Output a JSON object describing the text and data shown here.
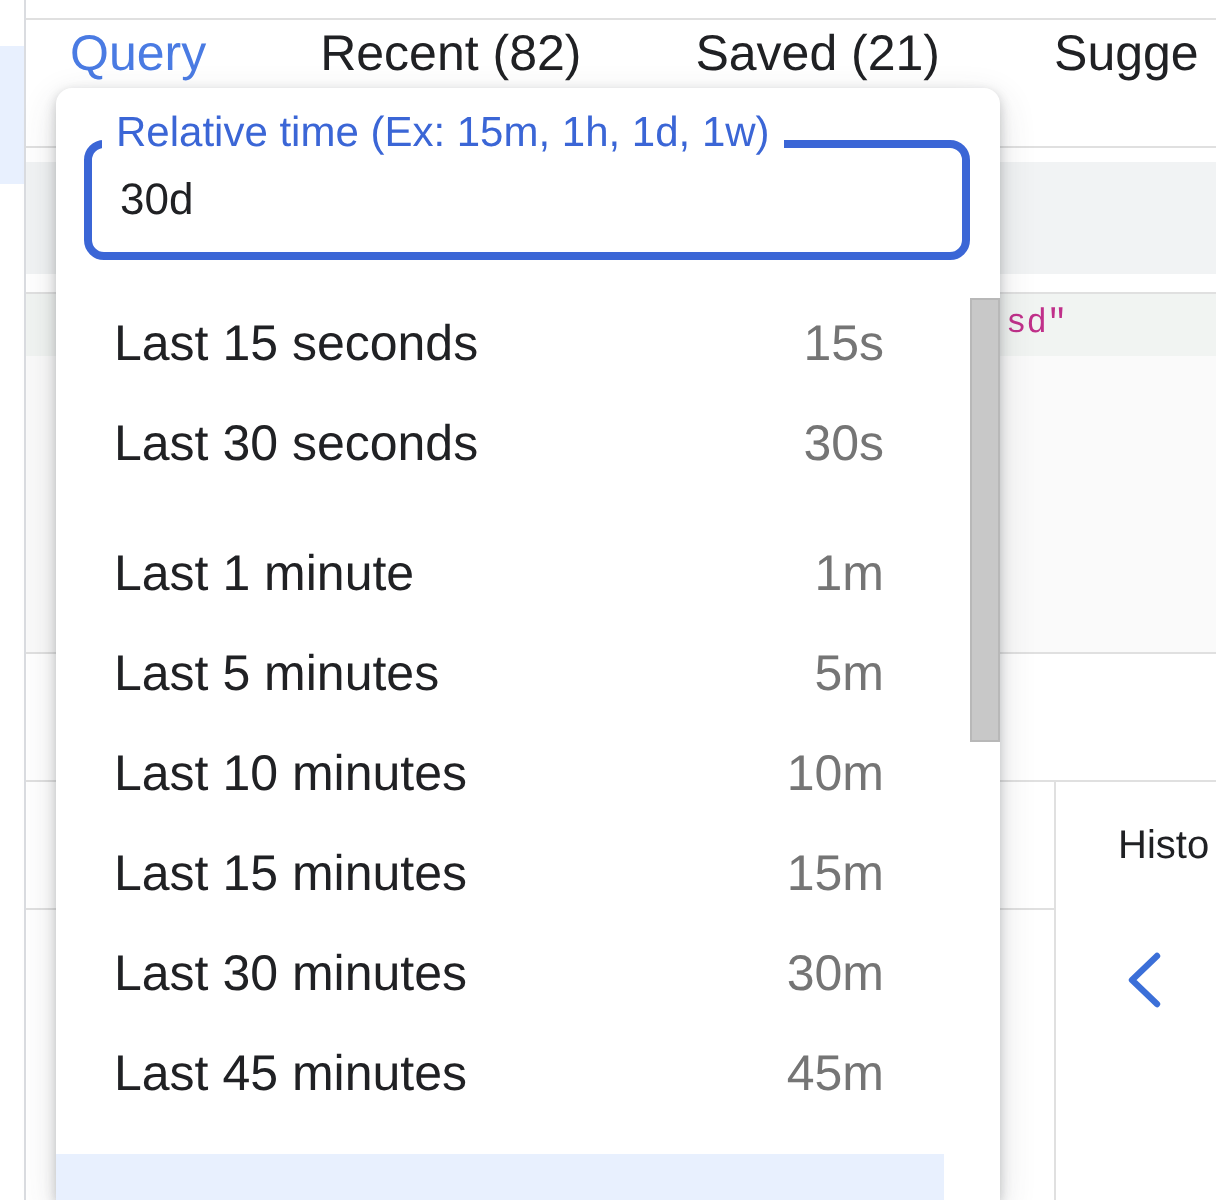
{
  "tabs": [
    {
      "label": "Query",
      "selected": true
    },
    {
      "label": "Recent (82)",
      "selected": false
    },
    {
      "label": "Saved (21)",
      "selected": false
    },
    {
      "label": "Sugge",
      "selected": false
    }
  ],
  "editor": {
    "code_fragment": "sd\""
  },
  "side_panel": {
    "title": "Histo"
  },
  "time_picker": {
    "field": {
      "label": "Relative time (Ex: 15m, 1h, 1d, 1w)",
      "value": "30d",
      "focused": true
    },
    "groups": [
      {
        "items": [
          {
            "label": "Last 15 seconds",
            "shortcut": "15s",
            "selected": false
          },
          {
            "label": "Last 30 seconds",
            "shortcut": "30s",
            "selected": false
          }
        ]
      },
      {
        "items": [
          {
            "label": "Last 1 minute",
            "shortcut": "1m",
            "selected": false
          },
          {
            "label": "Last 5 minutes",
            "shortcut": "5m",
            "selected": false
          },
          {
            "label": "Last 10 minutes",
            "shortcut": "10m",
            "selected": false
          },
          {
            "label": "Last 15 minutes",
            "shortcut": "15m",
            "selected": false
          },
          {
            "label": "Last 30 minutes",
            "shortcut": "30m",
            "selected": false
          },
          {
            "label": "Last 45 minutes",
            "shortcut": "45m",
            "selected": false
          }
        ]
      },
      {
        "items": [
          {
            "selected": true
          }
        ]
      }
    ]
  }
}
